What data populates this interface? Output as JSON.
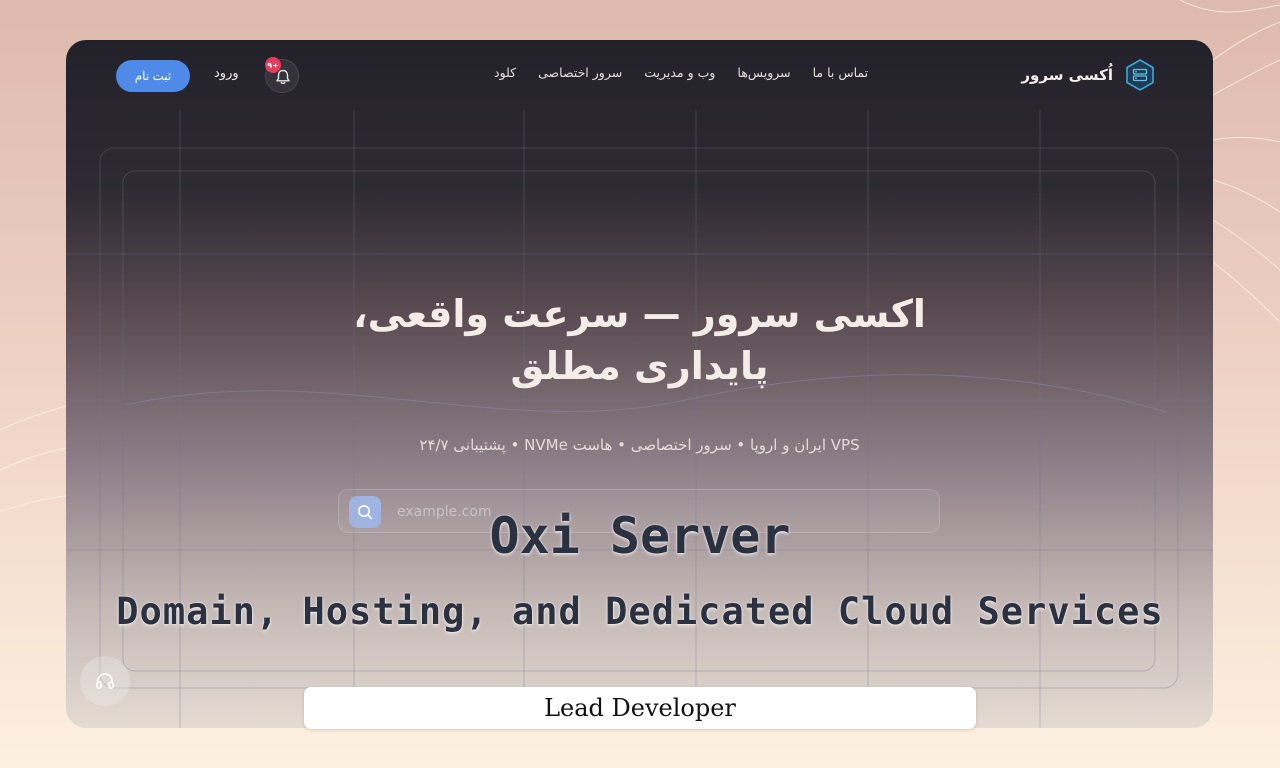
{
  "brand": {
    "name": "اُکسی سرور",
    "logo_icon": "hexagon-server-icon"
  },
  "nav": {
    "menu": [
      "کلود",
      "سرور اختصاصی",
      "وب و مدیریت",
      "سرویس‌ها",
      "تماس با ما"
    ],
    "login_label": "ورود",
    "register_label": "ثبت نام",
    "notification_count": "۹+",
    "accent_color": "#4f8ae8",
    "badge_color": "#e63b5b"
  },
  "hero": {
    "title_line1": "اکسی سرور — سرعت واقعی،",
    "title_line2": "پایداری مطلق",
    "subtitle": "VPS ایران و اروپا • سرور اختصاصی • هاست NVMe • پشتیبانی ۲۴/۷",
    "search_placeholder": "example.com"
  },
  "overlay": {
    "title": "Oxi Server",
    "subtitle": "Domain, Hosting, and Dedicated Cloud Services",
    "role": "Lead Developer"
  },
  "icons": {
    "search": "search-icon",
    "bell": "bell-icon",
    "support": "headset-icon"
  }
}
